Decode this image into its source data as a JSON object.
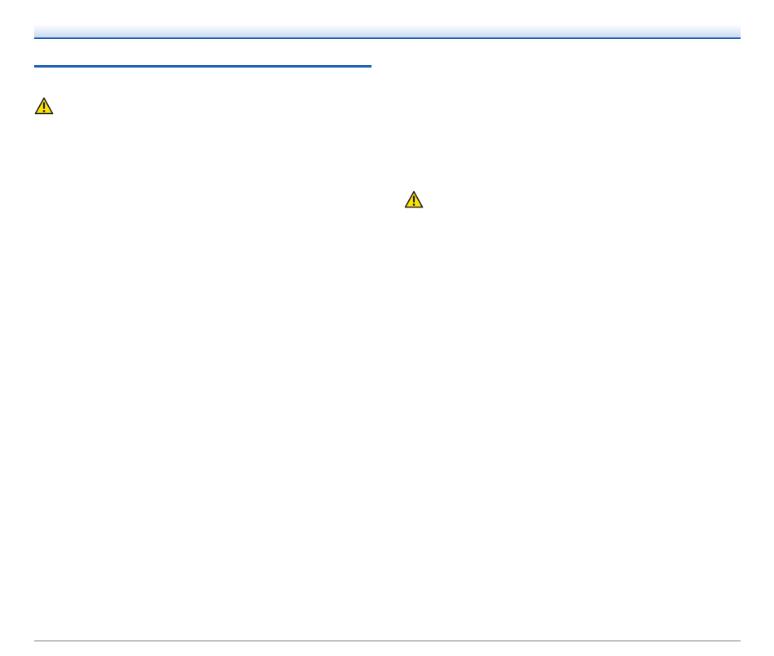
{
  "colors": {
    "accent_blue": "#1f5fb4",
    "header_gradient_light": "#e6effa",
    "header_gradient_dark": "#c9daf1",
    "warning_fill": "#ffe100",
    "warning_stroke": "#222222",
    "footer_rule": "#7a7a7a",
    "background": "#ffffff"
  },
  "icons": {
    "left_warning": "warning-triangle-icon",
    "right_warning": "warning-triangle-icon"
  }
}
